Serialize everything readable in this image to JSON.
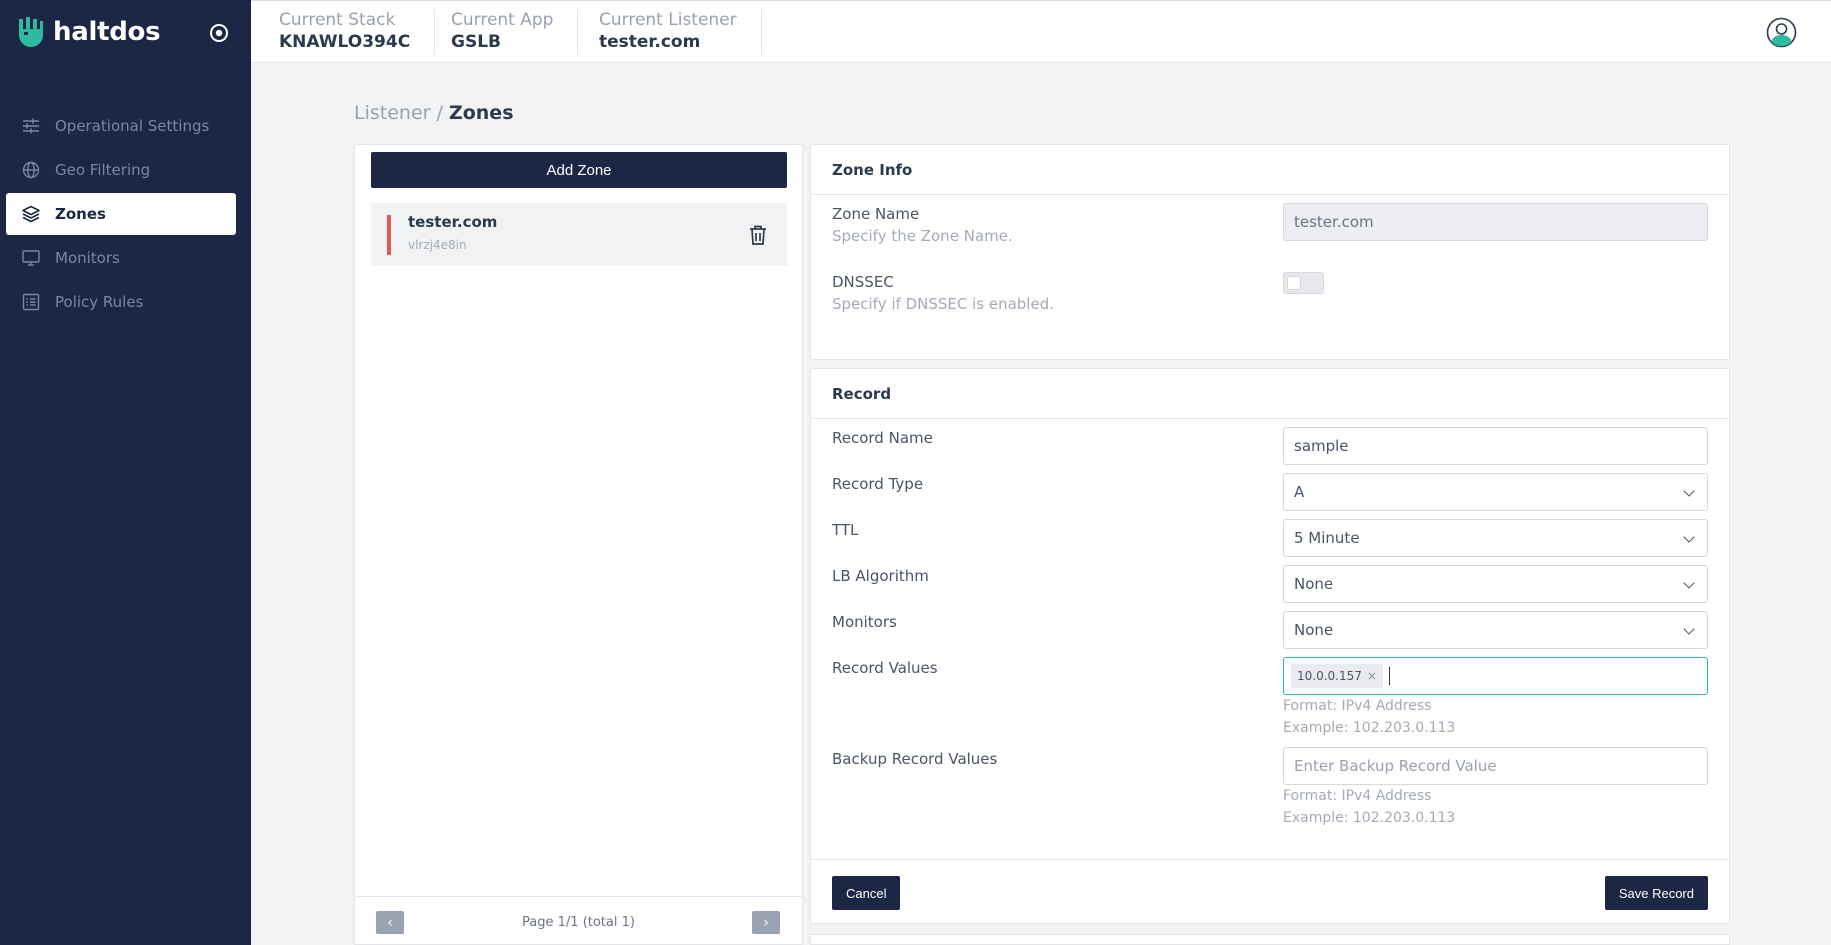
{
  "brand": {
    "name": "haltdos",
    "accent": "#2fb9a0",
    "nav_bg": "#1b2744"
  },
  "sidebar": {
    "items": [
      {
        "label": "Operational Settings",
        "icon": "sliders-icon",
        "active": false
      },
      {
        "label": "Geo Filtering",
        "icon": "globe-icon",
        "active": false
      },
      {
        "label": "Zones",
        "icon": "layers-icon",
        "active": true
      },
      {
        "label": "Monitors",
        "icon": "monitor-icon",
        "active": false
      },
      {
        "label": "Policy Rules",
        "icon": "list-icon",
        "active": false
      }
    ]
  },
  "header": {
    "stack": {
      "label": "Current Stack",
      "value": "KNAWLO394C"
    },
    "app": {
      "label": "Current App",
      "value": "GSLB"
    },
    "listener": {
      "label": "Current Listener",
      "value": "tester.com"
    }
  },
  "breadcrumb": {
    "parent": "Listener",
    "separator": "/",
    "current": "Zones"
  },
  "zones": {
    "add_label": "Add Zone",
    "items": [
      {
        "name": "tester.com",
        "id": "vlrzj4e8in"
      }
    ],
    "pager": {
      "text": "Page 1/1 (total 1)"
    }
  },
  "zone_info": {
    "title": "Zone Info",
    "zone_name": {
      "label": "Zone Name",
      "help": "Specify the Zone Name.",
      "value": "tester.com"
    },
    "dnssec": {
      "label": "DNSSEC",
      "help": "Specify if DNSSEC is enabled.",
      "enabled": false
    }
  },
  "record": {
    "title": "Record",
    "name": {
      "label": "Record Name",
      "value": "sample"
    },
    "type": {
      "label": "Record Type",
      "value": "A"
    },
    "ttl": {
      "label": "TTL",
      "value": "5 Minute"
    },
    "lb": {
      "label": "LB Algorithm",
      "value": "None"
    },
    "monitors": {
      "label": "Monitors",
      "value": "None"
    },
    "values": {
      "label": "Record Values",
      "tags": [
        "10.0.0.157"
      ],
      "format": "Format: IPv4 Address",
      "example": "Example: 102.203.0.113"
    },
    "backup": {
      "label": "Backup Record Values",
      "placeholder": "Enter Backup Record Value",
      "format": "Format: IPv4 Address",
      "example": "Example: 102.203.0.113"
    },
    "cancel_label": "Cancel",
    "save_label": "Save Record"
  }
}
